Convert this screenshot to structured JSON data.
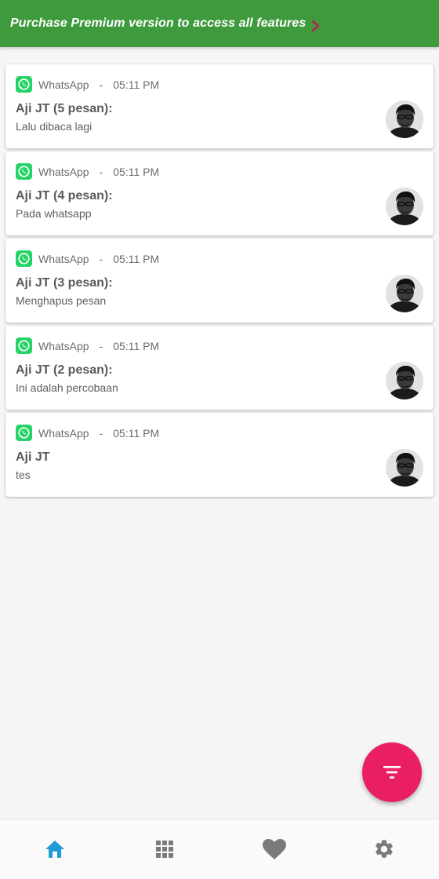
{
  "banner": {
    "text": "Purchase Premium version to access all features",
    "chevron_color": "#c2185b"
  },
  "colors": {
    "banner_bg": "#3f9a3d",
    "fab_bg": "#ea1f63",
    "nav_active": "#1e9bd7",
    "nav_inactive": "#7a7a7a",
    "whatsapp": "#25d366"
  },
  "notifications": [
    {
      "app": "WhatsApp",
      "separator": "-",
      "time": "05:11 PM",
      "title": "Aji JT (5 pesan):",
      "body": "Lalu dibaca lagi",
      "icon": "whatsapp-icon"
    },
    {
      "app": "WhatsApp",
      "separator": "-",
      "time": "05:11 PM",
      "title": "Aji JT (4 pesan):",
      "body": "Pada whatsapp",
      "icon": "whatsapp-icon"
    },
    {
      "app": "WhatsApp",
      "separator": "-",
      "time": "05:11 PM",
      "title": "Aji JT (3 pesan):",
      "body": "Menghapus pesan",
      "icon": "whatsapp-icon"
    },
    {
      "app": "WhatsApp",
      "separator": "-",
      "time": "05:11 PM",
      "title": "Aji JT (2 pesan):",
      "body": "Ini adalah percobaan",
      "icon": "whatsapp-icon"
    },
    {
      "app": "WhatsApp",
      "separator": "-",
      "time": "05:11 PM",
      "title": "Aji JT",
      "body": "tes",
      "icon": "whatsapp-icon"
    }
  ],
  "fab": {
    "icon": "filter-icon"
  },
  "bottom_nav": [
    {
      "icon": "home-icon",
      "active": true
    },
    {
      "icon": "apps-grid-icon",
      "active": false
    },
    {
      "icon": "heart-icon",
      "active": false
    },
    {
      "icon": "gear-icon",
      "active": false
    }
  ]
}
